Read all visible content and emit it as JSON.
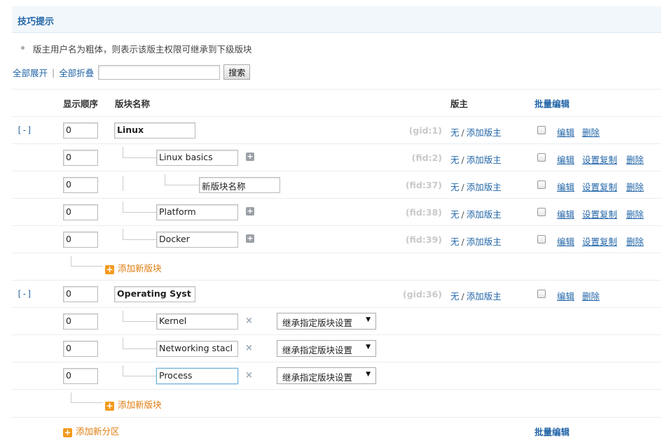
{
  "tips": {
    "title": "技巧提示",
    "line": "版主用户名为粗体，则表示该版主权限可继承到下级版块"
  },
  "search": {
    "expand_all": "全部展开",
    "sep": "|",
    "collapse_all": "全部折叠",
    "value": "",
    "button": "搜索"
  },
  "table": {
    "headers": {
      "order": "显示顺序",
      "name": "版块名称",
      "moderator": "版主",
      "batch_edit": "批量编辑"
    },
    "mod_none": "无",
    "mod_slash": "/",
    "mod_add": "添加版主",
    "edit": "编辑",
    "copy": "设置复制",
    "delete": "删除",
    "toggle": "[-]",
    "inherit_option": "继承指定版块设置",
    "add_board": "添加新版块",
    "add_group": "添加新分区",
    "batch_edit_footer": "批量编辑"
  },
  "rows": [
    {
      "kind": "group",
      "order": "0",
      "name": "Linux",
      "id": "(gid:1)"
    },
    {
      "kind": "forum",
      "order": "0",
      "name": "Linux basics",
      "id": "(fid:2)"
    },
    {
      "kind": "sub",
      "order": "0",
      "name": "新版块名称",
      "id": "(fid:37)"
    },
    {
      "kind": "forum",
      "order": "0",
      "name": "Platform",
      "id": "(fid:38)"
    },
    {
      "kind": "forum",
      "order": "0",
      "name": "Docker",
      "id": "(fid:39)"
    },
    {
      "kind": "group",
      "order": "0",
      "name": "Operating Syst",
      "id": "(gid:36)"
    },
    {
      "kind": "new",
      "order": "0",
      "name": "Kernel"
    },
    {
      "kind": "new",
      "order": "0",
      "name": "Networking stacl"
    },
    {
      "kind": "new",
      "order": "0",
      "name": "Process"
    }
  ],
  "icons": {
    "plus": "plus-square-icon",
    "remove": "x-icon",
    "add": "add-orange-icon",
    "dropdown": "chevron-down-icon"
  },
  "colors": {
    "link": "#2366a8",
    "add": "#e07d10",
    "id_gray": "#c9c9c9"
  }
}
